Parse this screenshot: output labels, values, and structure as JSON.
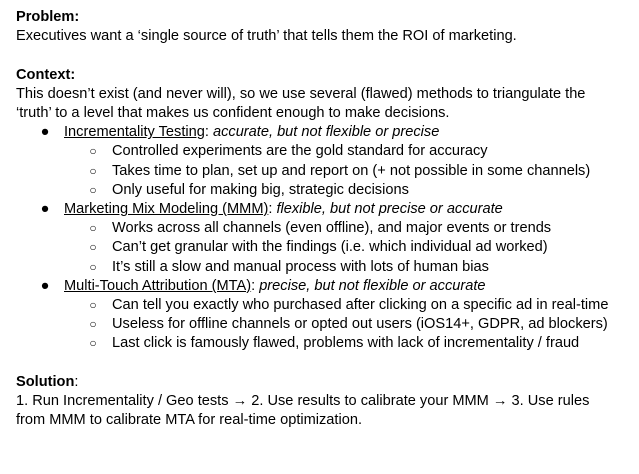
{
  "problem": {
    "heading": "Problem:",
    "text": "Executives want a ‘single source of truth’ that tells them the ROI of marketing."
  },
  "context": {
    "heading": "Context:",
    "line1": "This doesn’t exist (and never will), so we use several (flawed) methods to triangulate the",
    "line2": "‘truth’ to a level that makes us confident enough to make decisions."
  },
  "bullet_glyphs": {
    "level1": "●",
    "level2": "○"
  },
  "methods": [
    {
      "name": "Incrementality Testing",
      "sep": ": ",
      "summary": "accurate, but not flexible or precise",
      "points": [
        "Controlled experiments are the gold standard for accuracy",
        "Takes time to plan, set up and report on (+ not possible in some channels)",
        "Only useful for making big, strategic decisions"
      ]
    },
    {
      "name": "Marketing Mix Modeling (MMM)",
      "sep": ": ",
      "summary": "flexible, but not precise or accurate",
      "points": [
        "Works across all channels (even offline), and major events or trends",
        "Can’t get granular with the findings (i.e. which individual ad worked)",
        "It’s still a slow and manual process with lots of human bias"
      ]
    },
    {
      "name": "Multi-Touch Attribution (MTA)",
      "sep": ": ",
      "summary": "precise, but not flexible or accurate",
      "points": [
        "Can tell you exactly who purchased after clicking on a specific ad in real-time",
        "Useless for offline channels or opted out users (iOS14+, GDPR, ad blockers)",
        "Last click is famously flawed, problems with lack of incrementality / fraud"
      ]
    }
  ],
  "solution": {
    "heading": "Solution",
    "colon": ":",
    "line1": "1. Run Incrementality / Geo tests → 2. Use results to calibrate your MMM → 3. Use rules",
    "line2": "from MMM to calibrate MTA for real-time optimization."
  }
}
